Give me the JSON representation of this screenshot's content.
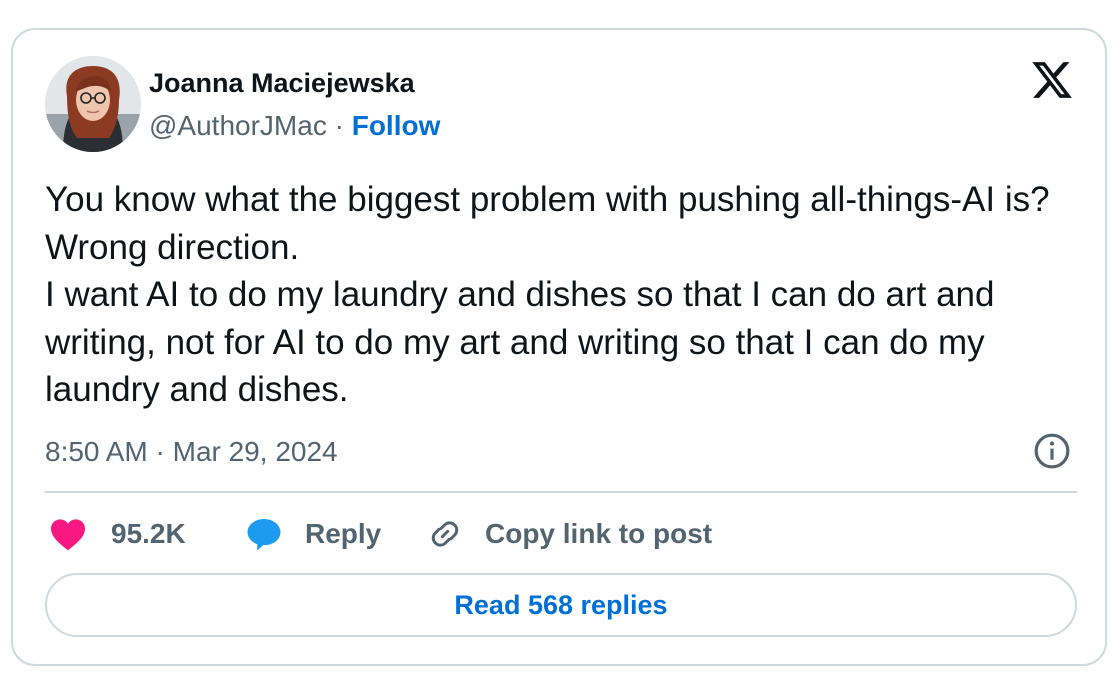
{
  "author": {
    "name": "Joanna Maciejewska",
    "handle": "@AuthorJMac",
    "separator": "·",
    "follow_label": "Follow",
    "avatar_icon": "profile-photo"
  },
  "platform": {
    "logo_icon": "x-logo"
  },
  "tweet": {
    "lines": [
      "You know what the biggest problem with pushing all-things-AI is? Wrong direction.",
      "I want AI to do my laundry and dishes so that I can do art and writing, not for AI to do my art and writing so that I can do my laundry and dishes."
    ],
    "timestamp": "8:50 AM · Mar 29, 2024",
    "info_icon": "info-icon"
  },
  "actions": {
    "like_count": "95.2K",
    "like_icon": "heart-icon",
    "reply_label": "Reply",
    "reply_icon": "speech-bubble-icon",
    "copy_label": "Copy link to post",
    "copy_icon": "link-icon"
  },
  "read_replies_label": "Read 568 replies",
  "colors": {
    "accent": "#006fd6",
    "like": "#f91880",
    "reply": "#1d9bf0",
    "muted": "#536471",
    "border": "#cfd9de",
    "text": "#0f1419"
  }
}
